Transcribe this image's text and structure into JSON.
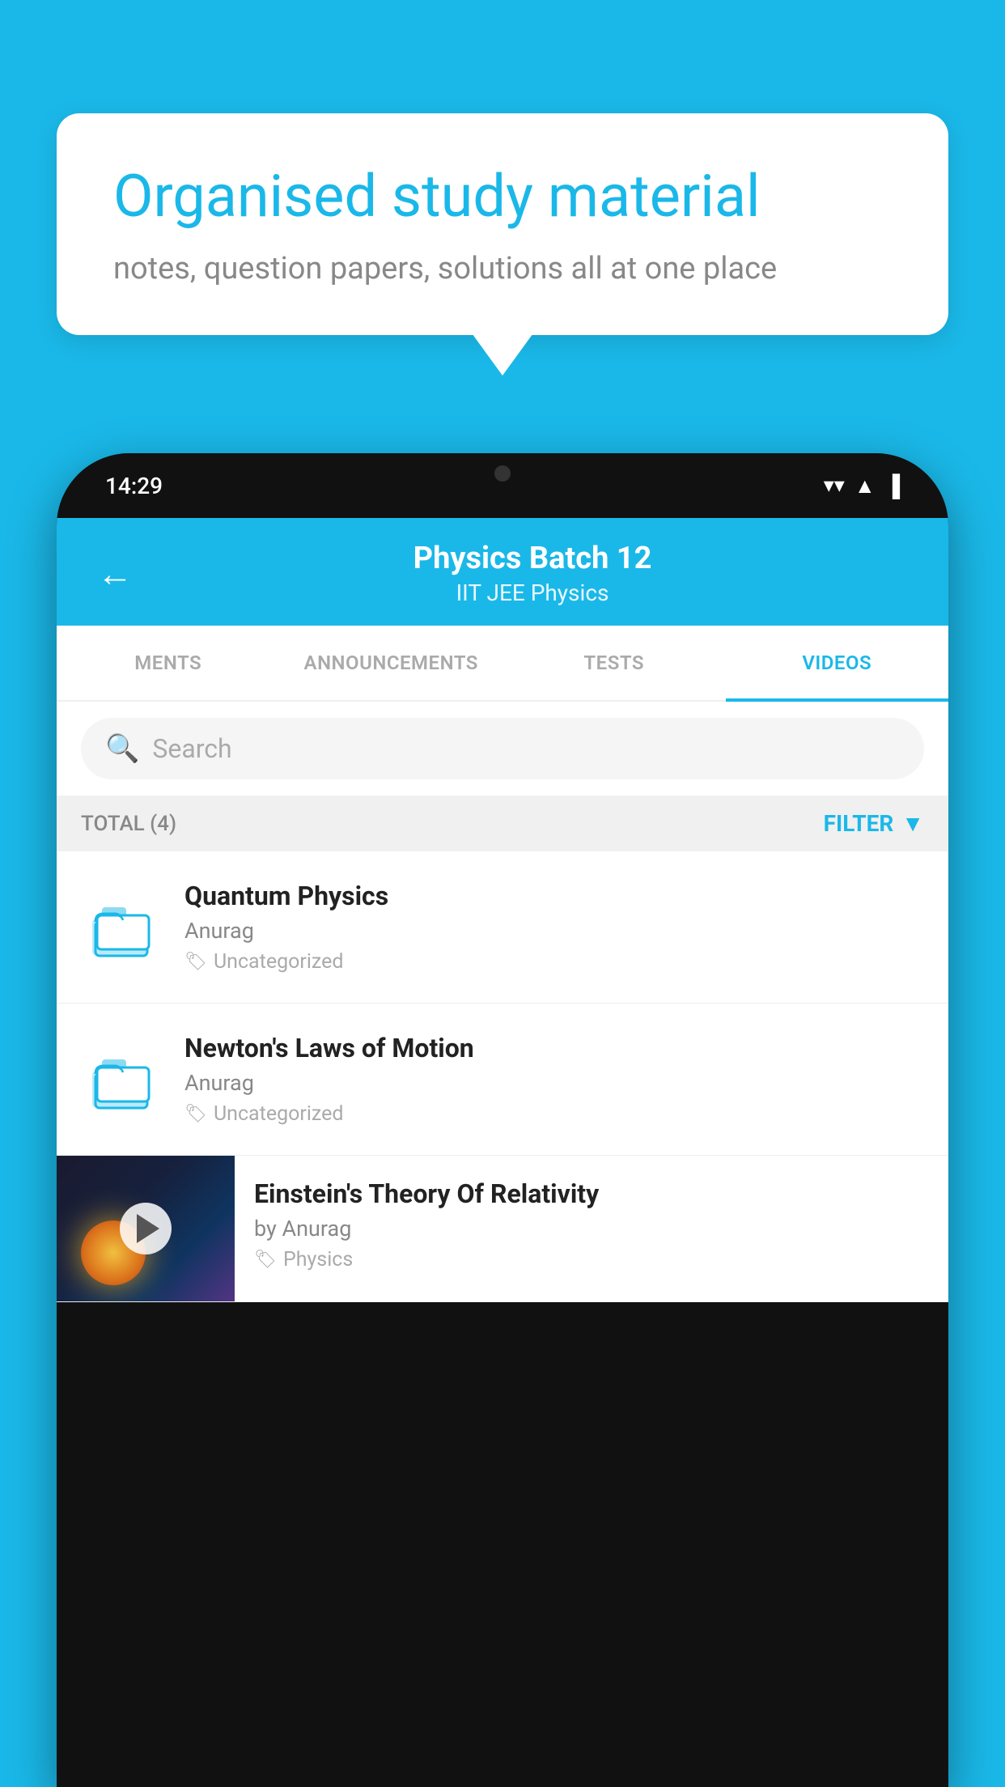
{
  "page": {
    "background_color": "#1ab8e8"
  },
  "bubble": {
    "title": "Organised study material",
    "subtitle": "notes, question papers, solutions all at one place"
  },
  "phone": {
    "status_bar": {
      "time": "14:29"
    },
    "header": {
      "back_label": "←",
      "title": "Physics Batch 12",
      "subtitle": "IIT JEE   Physics"
    },
    "tabs": [
      {
        "label": "MENTS",
        "active": false
      },
      {
        "label": "ANNOUNCEMENTS",
        "active": false
      },
      {
        "label": "TESTS",
        "active": false
      },
      {
        "label": "VIDEOS",
        "active": true
      }
    ],
    "search": {
      "placeholder": "Search"
    },
    "filter_bar": {
      "total_label": "TOTAL (4)",
      "filter_label": "FILTER"
    },
    "videos": [
      {
        "title": "Quantum Physics",
        "author": "Anurag",
        "tag": "Uncategorized",
        "type": "folder",
        "has_thumbnail": false
      },
      {
        "title": "Newton's Laws of Motion",
        "author": "Anurag",
        "tag": "Uncategorized",
        "type": "folder",
        "has_thumbnail": false
      },
      {
        "title": "Einstein's Theory Of Relativity",
        "author": "by Anurag",
        "tag": "Physics",
        "type": "video",
        "has_thumbnail": true
      }
    ]
  }
}
